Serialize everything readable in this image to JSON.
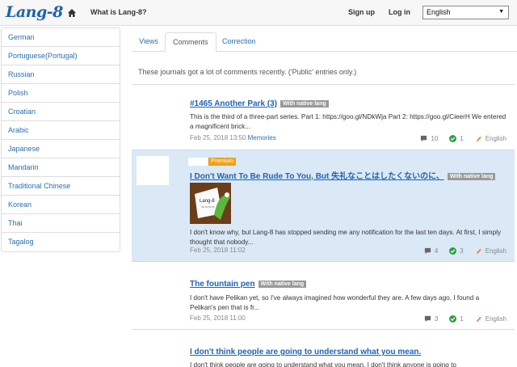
{
  "header": {
    "logo": "Lang-8",
    "what_is": "What is Lang-8?",
    "sign_up": "Sign up",
    "log_in": "Log in",
    "language": "English"
  },
  "sidebar": {
    "items": [
      "German",
      "Portuguese(Portugal)",
      "Russian",
      "Polish",
      "Croatian",
      "Arabic",
      "Japanese",
      "Mandarin",
      "Traditional Chinese",
      "Korean",
      "Thai",
      "Tagalog"
    ]
  },
  "tabs": [
    "Views",
    "Comments",
    "Correction"
  ],
  "notice": "These journals got a lot of comments recently. ('Public' entries only.)",
  "entries": [
    {
      "title": "#1465 Another Park (3)",
      "badge": "With native lang",
      "excerpt": "This is the third of a three-part series. Part 1: https://goo.gl/NDkWja Part 2: https://goo.gl/CieerH We entered a magnificent brick...",
      "date": "Feb 25, 2018 13:50",
      "memories": "Memories",
      "comments": "10",
      "corrections": "1",
      "language": "English"
    },
    {
      "premium": "Premium",
      "title": "I Don't Want To Be Rude To You, But 失礼なことはしたくないのに、",
      "badge": "With native lang",
      "excerpt": "I don't know why, but Lang-8 has stopped sending me any notification for the last ten days. At first, I simply thought that nobody...",
      "date": "Feb 25, 2018 11:02",
      "comments": "4",
      "corrections": "3",
      "language": "English"
    },
    {
      "title": "The fountain pen",
      "badge": "With native lang",
      "excerpt": "I don't have Pelikan yet, so I've always imagined how wonderful they are. A few days ago, I found a Pelikan's pen that is fr...",
      "date": "Feb 25, 2018 11:00",
      "comments": "3",
      "corrections": "1",
      "language": "English"
    },
    {
      "title": "I don't think people are going to understand what you mean.",
      "excerpt": "I don't think people are going to understand what you mean. I don't think anyone is going to"
    }
  ],
  "colors": {
    "link": "#1f63b3",
    "highlight": "#dbe9f6",
    "premium": "#f0a020",
    "check": "#2ea043",
    "pencil": "#f08030"
  }
}
